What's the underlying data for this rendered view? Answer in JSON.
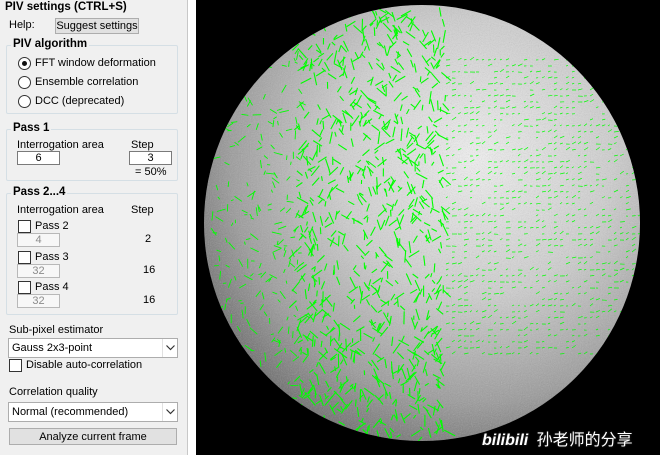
{
  "panel": {
    "title": "PIV settings (CTRL+S)",
    "help_label": "Help:",
    "suggest_button": "Suggest settings"
  },
  "algorithm": {
    "title": "PIV algorithm",
    "options": [
      {
        "label": "FFT window deformation",
        "selected": true
      },
      {
        "label": "Ensemble correlation",
        "selected": false
      },
      {
        "label": "DCC (deprecated)",
        "selected": false
      }
    ]
  },
  "pass1": {
    "title": "Pass 1",
    "area_label": "Interrogation area",
    "step_label": "Step",
    "area_value": "6",
    "step_value": "3",
    "overlap": "= 50%"
  },
  "pass2to4": {
    "title": "Pass 2...4",
    "area_label": "Interrogation area",
    "step_label": "Step",
    "passes": [
      {
        "label": "Pass 2",
        "checked": false,
        "area": "4",
        "step": "2"
      },
      {
        "label": "Pass 3",
        "checked": false,
        "area": "32",
        "step": "16"
      },
      {
        "label": "Pass 4",
        "checked": false,
        "area": "32",
        "step": "16"
      }
    ]
  },
  "subpixel": {
    "label": "Sub-pixel estimator",
    "value": "Gauss 2x3-point",
    "disable_autocorr_label": "Disable auto-correlation",
    "disable_autocorr_checked": false
  },
  "quality": {
    "label": "Correlation quality",
    "value": "Normal (recommended)"
  },
  "analyze_button": "Analyze current frame",
  "watermark": {
    "logo": "bilibili",
    "text": "孙老师的分享"
  },
  "colors": {
    "panel_bg": "#f0f0f0",
    "vector_color": "#00ff00",
    "background": "#000000"
  }
}
